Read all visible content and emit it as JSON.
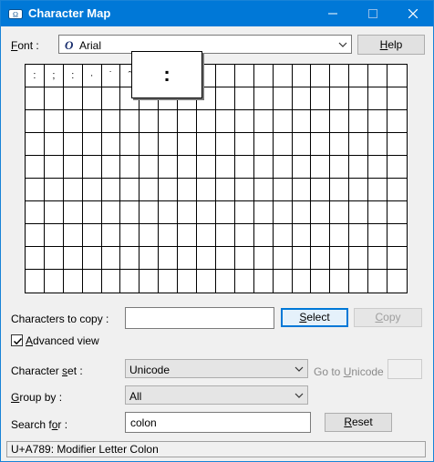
{
  "window": {
    "title": "Character Map"
  },
  "titlebar": {
    "minimize": "—",
    "maximize": "☐",
    "close": "✕"
  },
  "font": {
    "label_pre": "",
    "label_mnemonic": "F",
    "label_post": "ont :",
    "value": "Arial",
    "icon_glyph": "O"
  },
  "help_button": {
    "mnemonic": "H",
    "rest": "elp"
  },
  "grid": {
    "cells": [
      ":",
      ";",
      ":",
      "·",
      "˙",
      "ˆ",
      "",
      "",
      "",
      "",
      "",
      "",
      "",
      "",
      "",
      "",
      "",
      "",
      "",
      ""
    ],
    "magnified_char": ":"
  },
  "copy": {
    "label": "Characters to copy :",
    "value": "",
    "select_mnemonic": "S",
    "select_rest": "elect",
    "copy_mnemonic": "C",
    "copy_rest": "opy"
  },
  "advanced_view": {
    "mnemonic": "A",
    "rest": "dvanced view",
    "checked": true
  },
  "character_set": {
    "label_pre": "Character ",
    "label_mnemonic": "s",
    "label_post": "et :",
    "value": "Unicode",
    "goto_pre": "Go to ",
    "goto_mnemonic": "U",
    "goto_post": "nicode :",
    "goto_value": ""
  },
  "group_by": {
    "label_mnemonic": "G",
    "label_post": "roup by :",
    "value": "All"
  },
  "search": {
    "label_pre": "Search f",
    "label_mnemonic": "o",
    "label_post": "r :",
    "value": "colon",
    "reset_mnemonic": "R",
    "reset_rest": "eset"
  },
  "status": {
    "text": "U+A789: Modifier Letter Colon"
  }
}
